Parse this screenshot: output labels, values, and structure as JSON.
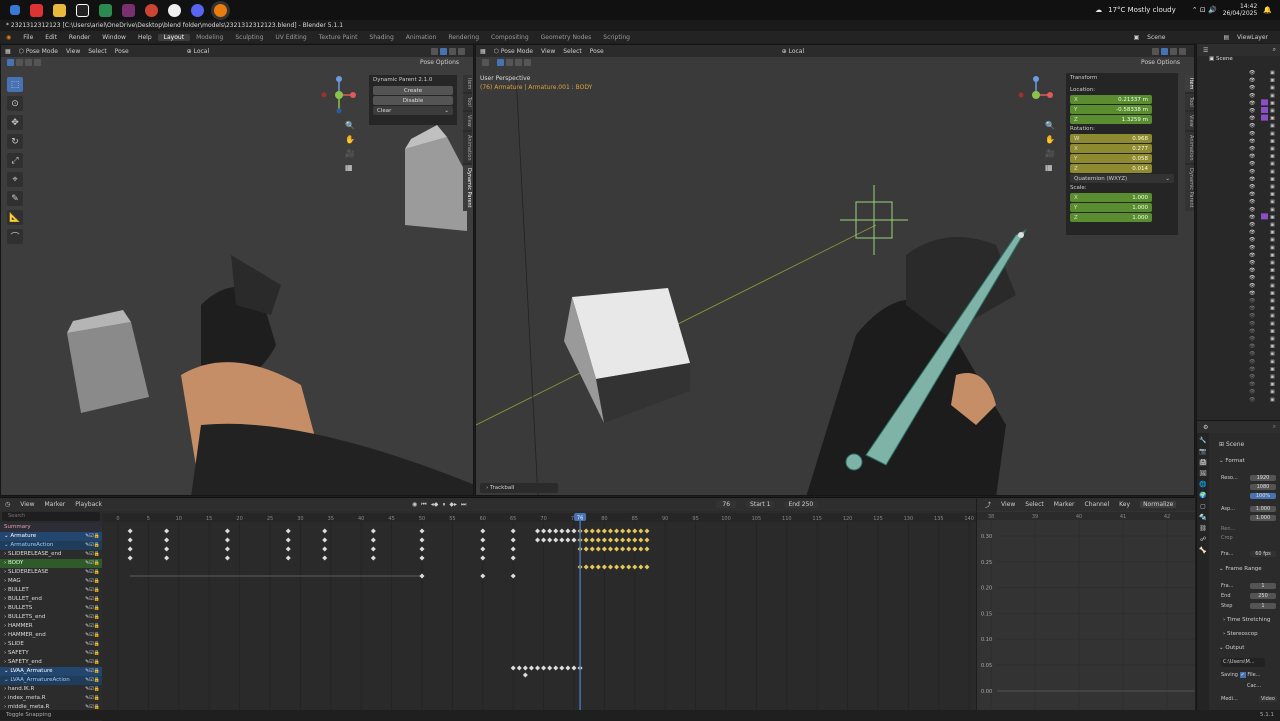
{
  "taskbar": {
    "weather": "17°C  Mostly cloudy",
    "time": "14:42",
    "date": "26/04/2025"
  },
  "window": {
    "title": "* 2321312312123 [C:\\Users\\ariel\\OneDrive\\Desktop\\blend folder\\models\\2321312312123.blend] - Blender 5.1.1"
  },
  "menu": [
    "File",
    "Edit",
    "Render",
    "Window",
    "Help"
  ],
  "workspaces": [
    "Layout",
    "Modeling",
    "Sculpting",
    "UV Editing",
    "Texture Paint",
    "Shading",
    "Animation",
    "Rendering",
    "Compositing",
    "Geometry Nodes",
    "Scripting"
  ],
  "scene_name": "Scene",
  "view_layer": "ViewLayer",
  "left_viewport": {
    "mode": "Pose Mode",
    "menus": [
      "View",
      "Select",
      "Pose"
    ],
    "orientation": "Local",
    "pose_options": "Pose Options",
    "dynamic_parent": {
      "title": "Dynamic Parent 2.1.0",
      "create": "Create",
      "disable": "Disable",
      "clear": "Clear"
    },
    "side_tabs": [
      "Item",
      "Tool",
      "View",
      "Animation",
      "Dynamic Parent"
    ]
  },
  "right_viewport": {
    "mode": "Pose Mode",
    "menus": [
      "View",
      "Select",
      "Pose"
    ],
    "orientation": "Local",
    "pose_options": "Pose Options",
    "view_name": "User Perspective",
    "context": "(76) Armature | Armature.001 : BODY",
    "trackball": "Trackball",
    "transform": {
      "title": "Transform",
      "location_label": "Location:",
      "location": [
        [
          "X",
          "0.21337 m"
        ],
        [
          "Y",
          "-0.58338 m"
        ],
        [
          "Z",
          "1.3259 m"
        ]
      ],
      "rotation_label": "Rotation:",
      "rotation": [
        [
          "W",
          "0.968"
        ],
        [
          "X",
          "0.277"
        ],
        [
          "Y",
          "0.058"
        ],
        [
          "Z",
          "0.014"
        ]
      ],
      "rotation_mode": "Quaternion (WXYZ)",
      "scale_label": "Scale:",
      "scale": [
        [
          "X",
          "1.000"
        ],
        [
          "Y",
          "1.000"
        ],
        [
          "Z",
          "1.000"
        ]
      ]
    },
    "side_tabs": [
      "Item",
      "Tool",
      "View",
      "Animation",
      "Dynamic Parent"
    ]
  },
  "dopesheet": {
    "menus": [
      "View",
      "Marker",
      "Playback"
    ],
    "current_frame": "76",
    "start_label": "Start",
    "start": "1",
    "end_label": "End",
    "end": "250",
    "search_placeholder": "Search",
    "ruler": [
      "0",
      "5",
      "10",
      "15",
      "20",
      "25",
      "30",
      "35",
      "40",
      "45",
      "50",
      "55",
      "60",
      "65",
      "70",
      "75",
      "80",
      "85",
      "90",
      "95",
      "100",
      "105",
      "110",
      "115",
      "120",
      "125",
      "130",
      "135",
      "140"
    ],
    "channels": [
      {
        "name": "Summary",
        "kind": "summary"
      },
      {
        "name": "Armature",
        "kind": "object"
      },
      {
        "name": "ArmatureAction",
        "kind": "action"
      },
      {
        "name": "SLIDERELEASE_end",
        "kind": "group"
      },
      {
        "name": "BODY",
        "kind": "green"
      },
      {
        "name": "SLIDERELEASE",
        "kind": "group"
      },
      {
        "name": "MAG",
        "kind": "group"
      },
      {
        "name": "BULLET",
        "kind": "group"
      },
      {
        "name": "BULLET_end",
        "kind": "group"
      },
      {
        "name": "BULLETS",
        "kind": "group"
      },
      {
        "name": "BULLETS_end",
        "kind": "group"
      },
      {
        "name": "HAMMER",
        "kind": "group"
      },
      {
        "name": "HAMMER_end",
        "kind": "group"
      },
      {
        "name": "SLIDE",
        "kind": "group"
      },
      {
        "name": "SAFETY",
        "kind": "group"
      },
      {
        "name": "SAFETY_end",
        "kind": "group"
      },
      {
        "name": "LVAA_Armature",
        "kind": "object"
      },
      {
        "name": "LVAA_ArmatureAction",
        "kind": "action"
      },
      {
        "name": "hand.IK.R",
        "kind": "group"
      },
      {
        "name": "index_meta.R",
        "kind": "group"
      },
      {
        "name": "middle_meta.R",
        "kind": "group"
      }
    ]
  },
  "graph_editor": {
    "menus": [
      "View",
      "Select",
      "Marker",
      "Channel",
      "Key"
    ],
    "normalize": "Normalize",
    "y_ticks": [
      "0.30",
      "0.25",
      "0.20",
      "0.15",
      "0.10",
      "0.05",
      "0.00"
    ],
    "x_ticks": [
      "38",
      "39",
      "40",
      "41",
      "42"
    ]
  },
  "properties": {
    "scene": "Scene",
    "format": "Format",
    "resolution_label": "Reso...",
    "res_x": "1920",
    "res_y": "1080",
    "res_pct": "100%",
    "aspect_label": "Asp...",
    "aspect_x": "1.000",
    "aspect_y": "1.000",
    "render_region": "Ren...",
    "crop": "Crop",
    "frame_rate_label": "Fra...",
    "frame_rate": "60 fps",
    "frame_range": "Frame Range",
    "frame_start_label": "Fra...",
    "frame_start": "1",
    "frame_end_label": "End",
    "frame_end": "250",
    "step_label": "Step",
    "step": "1",
    "time_stretching": "Time Stretching",
    "stereoscopy": "Stereoscop",
    "output": "Output",
    "output_path": "C:\\Users\\M...",
    "saving_label": "Saving",
    "file_ext": "File...",
    "cache": "Cac...",
    "media_label": "Medi...",
    "media": "Video"
  },
  "statusbar": {
    "left": "Toggle Snapping",
    "version": "5.1.1"
  },
  "colors": {
    "accent": "#4772b3",
    "keyframe": "#e6c85a",
    "playhead": "#4772b3",
    "selection_green": "#9bd27a"
  }
}
